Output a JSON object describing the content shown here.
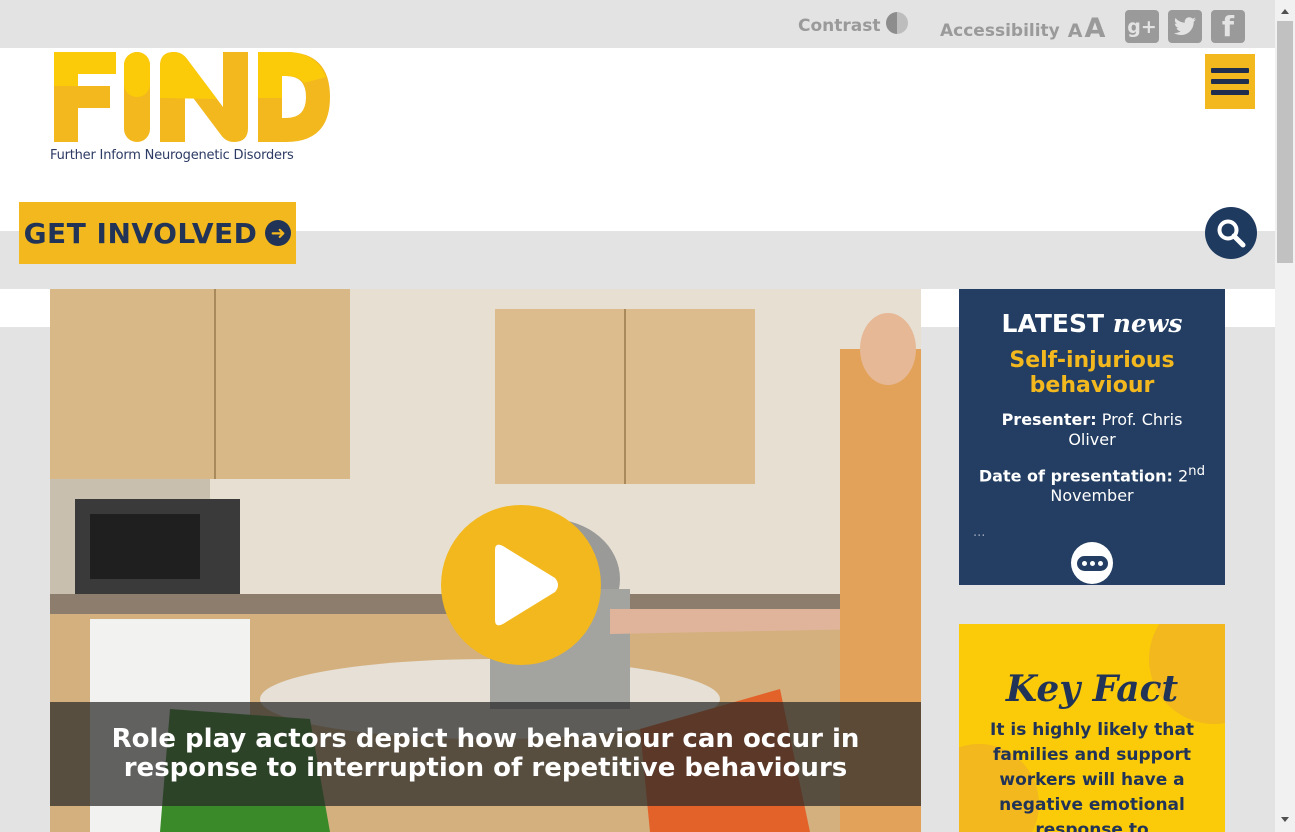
{
  "topbar": {
    "contrast_label": "Contrast",
    "accessibility_label": "Accessibility",
    "accessibility_small": "A",
    "accessibility_large": "A",
    "social": {
      "gplus": "g+",
      "twitter": "twitter",
      "facebook": "f"
    }
  },
  "brand": {
    "logo_text": "FIND",
    "tagline": "Further Inform Neurogenetic Disorders",
    "colors": {
      "yellow": "#f2b81e",
      "bright_yellow": "#fbcb0a",
      "navy": "#233e62"
    }
  },
  "nav": {
    "cta_label": "GET INVOLVED",
    "menu_icon": "hamburger-icon",
    "search_icon": "search-icon"
  },
  "video": {
    "caption": "Role play actors depict how behaviour can occur in response to interruption of repetitive behaviours",
    "play_icon": "play-icon"
  },
  "latest_news": {
    "title_bold": "LATEST",
    "title_script": "news",
    "headline": "Self-injurious behaviour",
    "presenter_label": "Presenter:",
    "presenter_value": "Prof. Chris Oliver",
    "date_label": "Date of presentation:",
    "date_day": "2",
    "date_suffix": "nd",
    "date_month": "November",
    "ellipsis": "...",
    "more_icon": "more-icon"
  },
  "key_fact": {
    "title": "Key Fact",
    "text": "It is highly likely that families and support workers will have a negative emotional response to challenging"
  }
}
